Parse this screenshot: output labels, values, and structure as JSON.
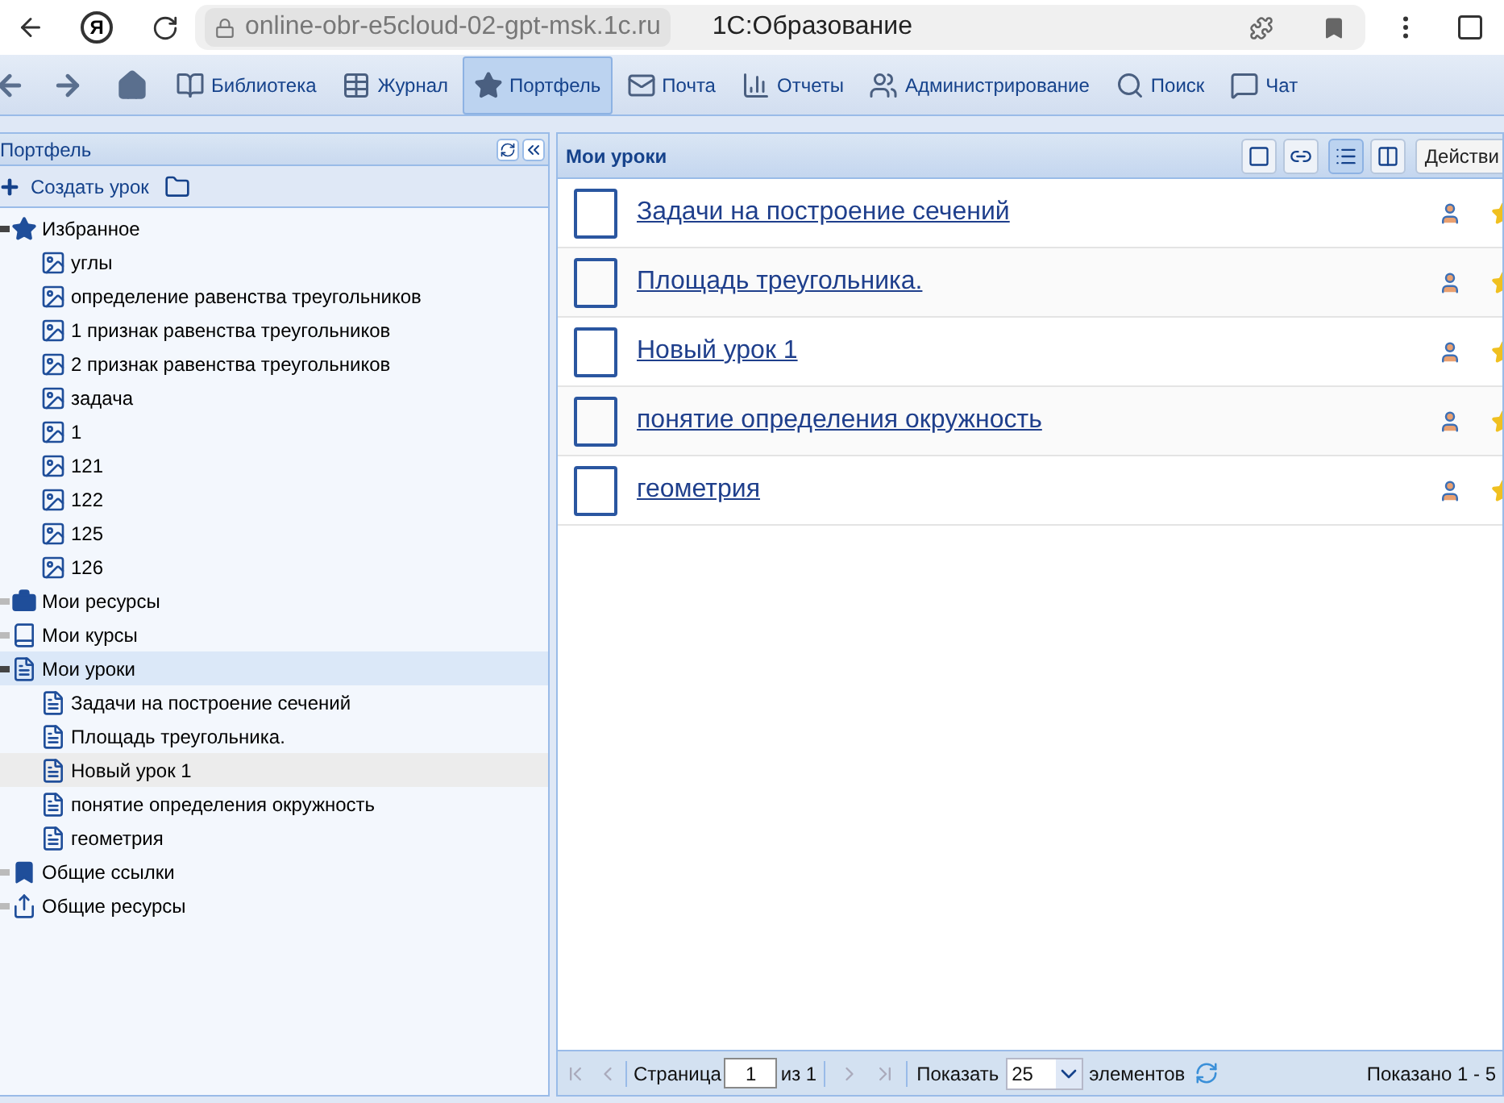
{
  "browser": {
    "logo": "Я",
    "address": "online-obr-e5cloud-02-gpt-msk.1c.ru",
    "page_title": "1С:Образование"
  },
  "nav": [
    {
      "label": "Библиотека",
      "kind": "book",
      "selected": false
    },
    {
      "label": "Журнал",
      "kind": "journal",
      "selected": false
    },
    {
      "label": "Портфель",
      "kind": "star",
      "selected": true
    },
    {
      "label": "Почта",
      "kind": "mail",
      "selected": false
    },
    {
      "label": "Отчеты",
      "kind": "chart",
      "selected": false
    },
    {
      "label": "Администрирование",
      "kind": "admin",
      "selected": false
    },
    {
      "label": "Поиск",
      "kind": "search",
      "selected": false
    },
    {
      "label": "Чат",
      "kind": "chat",
      "selected": false
    }
  ],
  "sidebar": {
    "title": "Портфель",
    "create_button": "Создать урок",
    "tree": [
      {
        "label": "Избранное",
        "kind": "star",
        "expanded": true,
        "selected": false,
        "hovered": false,
        "children": [
          {
            "label": "углы",
            "kind": "image",
            "selected": false,
            "hovered": false
          },
          {
            "label": "определение равенства треугольников",
            "kind": "image",
            "selected": false,
            "hovered": false
          },
          {
            "label": "1 признак равенства треугольников",
            "kind": "image",
            "selected": false,
            "hovered": false
          },
          {
            "label": "2 признак равенства треугольников",
            "kind": "image",
            "selected": false,
            "hovered": false
          },
          {
            "label": "задача",
            "kind": "image",
            "selected": false,
            "hovered": false
          },
          {
            "label": "1",
            "kind": "image",
            "selected": false,
            "hovered": false
          },
          {
            "label": "121",
            "kind": "image",
            "selected": false,
            "hovered": false
          },
          {
            "label": "122",
            "kind": "image",
            "selected": false,
            "hovered": false
          },
          {
            "label": "125",
            "kind": "image",
            "selected": false,
            "hovered": false
          },
          {
            "label": "126",
            "kind": "image",
            "selected": false,
            "hovered": false
          }
        ]
      },
      {
        "label": "Мои ресурсы",
        "kind": "briefcase",
        "expanded": false,
        "selected": false,
        "hovered": false
      },
      {
        "label": "Мои курсы",
        "kind": "course",
        "expanded": false,
        "selected": false,
        "hovered": false
      },
      {
        "label": "Мои уроки",
        "kind": "lessons",
        "expanded": true,
        "selected": true,
        "hovered": false,
        "children": [
          {
            "label": "Задачи на построение сечений",
            "kind": "lesson",
            "selected": false,
            "hovered": false
          },
          {
            "label": "Площадь треугольника.",
            "kind": "lesson",
            "selected": false,
            "hovered": false
          },
          {
            "label": "Новый урок 1",
            "kind": "lesson",
            "selected": false,
            "hovered": true
          },
          {
            "label": "понятие определения окружность",
            "kind": "lesson",
            "selected": false,
            "hovered": false
          },
          {
            "label": "геометрия",
            "kind": "lesson",
            "selected": false,
            "hovered": false
          }
        ]
      },
      {
        "label": "Общие ссылки",
        "kind": "bookmark",
        "expanded": false,
        "selected": false,
        "hovered": false
      },
      {
        "label": "Общие ресурсы",
        "kind": "share",
        "expanded": false,
        "selected": false,
        "hovered": false
      }
    ]
  },
  "main": {
    "title": "Мои уроки",
    "view_buttons": [
      {
        "kind": "window",
        "selected": false
      },
      {
        "kind": "link",
        "selected": false
      },
      {
        "kind": "list",
        "selected": true
      },
      {
        "kind": "tiles",
        "selected": false
      }
    ],
    "actions_button": "Действи",
    "lessons": [
      {
        "title": "Задачи на построение сечений",
        "checked": false
      },
      {
        "title": "Площадь треугольника.",
        "checked": false
      },
      {
        "title": "Новый урок 1",
        "checked": false
      },
      {
        "title": "понятие определения окружность",
        "checked": false
      },
      {
        "title": "геометрия",
        "checked": false
      }
    ],
    "pager": {
      "page_label": "Страница",
      "page": "1",
      "of": "из 1",
      "show_label": "Показать",
      "page_size": "25",
      "items_label": "элементов",
      "summary": "Показано 1 - 5"
    }
  }
}
